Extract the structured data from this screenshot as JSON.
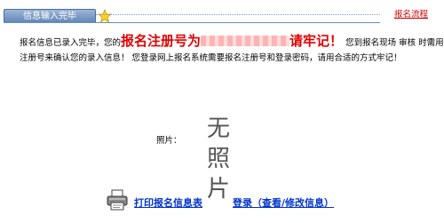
{
  "header": {
    "tab_label": "信息输入完毕",
    "process_link": "报名流程"
  },
  "message": {
    "line1_prefix": "报名信息已录入完毕，您的",
    "reg_label": "报名注册号为",
    "reg_suffix": "请牢记！",
    "line1_tail": " 您到报名现场 审核 时需用此",
    "line2": "注册号来确认您的录入信息！ 您登录网上报名系统需要报名注册号和登录密码，请用合适的方式牢记！"
  },
  "photo": {
    "label": "照片：",
    "placeholder": [
      "无",
      "照",
      "片"
    ]
  },
  "actions": {
    "print_label": "打印报名信息表",
    "login_label": "登录（查看/修改信息）"
  },
  "colors": {
    "accent_red": "#e00000",
    "link_blue": "#0033cc",
    "tab_blue": "#5f84b6"
  }
}
